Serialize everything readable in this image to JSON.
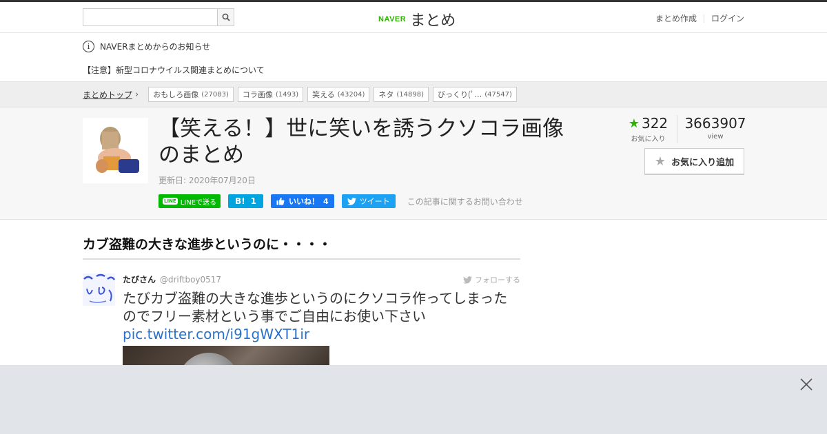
{
  "header": {
    "search_placeholder": "",
    "logo_brand": "NAVER",
    "logo_service": "まとめ",
    "links": [
      "まとめ作成",
      "ログイン"
    ]
  },
  "notice": {
    "title": "NAVERまとめからのお知らせ",
    "item": "【注意】新型コロナウイルス関連まとめについて"
  },
  "tagbar": {
    "crumb": "まとめトップ",
    "tags": [
      {
        "label": "おもしろ画像",
        "count": "(27083)"
      },
      {
        "label": "コラ画像",
        "count": "(1493)"
      },
      {
        "label": "笑える",
        "count": "(43204)"
      },
      {
        "label": "ネタ",
        "count": "(14898)"
      },
      {
        "label": "びっくり(ﾟ…",
        "count": "(47547)"
      }
    ]
  },
  "article": {
    "title": "【笑える！】世に笑いを誘うクソコラ画像のまとめ",
    "updated": "更新日: 2020年07月20日",
    "share": {
      "line": "LINEで送る",
      "line_badge": "LINE",
      "hatena_label": "B!",
      "hatena_count": "1",
      "fb_label": "いいね！",
      "fb_count": "4",
      "tweet": "ツイート",
      "inquiry": "この記事に関するお問い合わせ"
    },
    "favorites": {
      "count": "322",
      "label": "お気に入り"
    },
    "views": {
      "count": "3663907",
      "label": "view"
    },
    "fav_add": "お気に入り追加"
  },
  "content": {
    "section_heading": "カブ盗難の大きな進歩というのに・・・・",
    "tweet": {
      "name": "たびさん",
      "handle": "@driftboy0517",
      "follow": "フォローする",
      "text": "たびカブ盗難の大きな進歩というのにクソコラ作ってしまったのでフリー素材という事でご自由にお使い下さい",
      "link": "pic.twitter.com/i91gWXT1ir"
    }
  },
  "colors": {
    "naver_green": "#2db400",
    "link_blue": "#2a72c9",
    "line_green": "#00b900",
    "hatena_blue": "#00a4de",
    "facebook_blue": "#1877f2",
    "twitter_blue": "#1da1f2",
    "ad_overlay": "#e1e4e8"
  }
}
